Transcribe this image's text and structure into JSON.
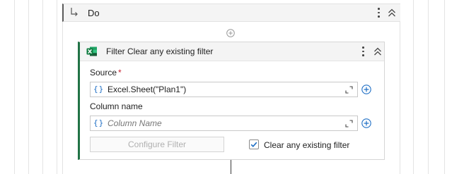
{
  "do_block": {
    "title": "Do"
  },
  "activity": {
    "title": "Filter Clear any existing filter",
    "source": {
      "label": "Source",
      "required_mark": "*",
      "braces": "{}",
      "value": "Excel.Sheet(\"Plan1\")"
    },
    "column_name": {
      "label": "Column name",
      "braces": "{}",
      "placeholder": "Column Name"
    },
    "configure_filter_label": "Configure Filter",
    "clear_filter_checkbox": {
      "label": "Clear any existing filter",
      "checked": true
    }
  },
  "colors": {
    "excel_green": "#217346",
    "accent_blue": "#1f6fc5"
  }
}
